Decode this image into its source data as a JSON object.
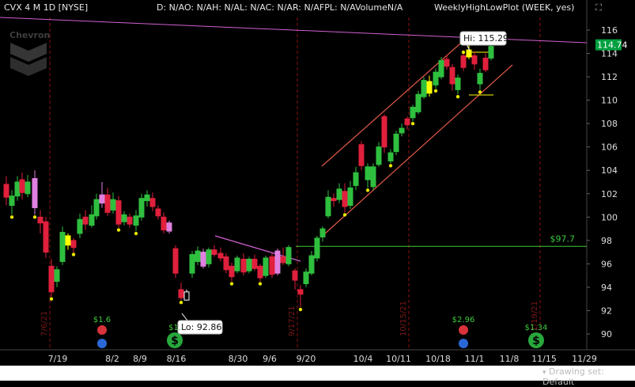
{
  "header": {
    "symbol_period": "CVX 4 M 1D [NYSE]",
    "study_values": "D: N/AO: N/AH: N/AL: N/AC: N/AR: N/AFPL: N/AVolumeN/A",
    "study_name": "WeeklyHighLowPlot (WEEK, yes)"
  },
  "watermark": {
    "brand": "Chevron"
  },
  "price_axis": {
    "ticks": [
      "116",
      "114",
      "112",
      "110",
      "108",
      "106",
      "104",
      "102",
      "100",
      "98",
      "96",
      "94",
      "92",
      "90"
    ],
    "current_price": "114.74",
    "current_price_color": "#00a040"
  },
  "time_axis": {
    "labels": [
      "7/19",
      "8/2",
      "8/9",
      "8/16",
      "8/30",
      "9/6",
      "9/20",
      "10/4",
      "10/11",
      "10/18",
      "11/1",
      "11/8",
      "11/15",
      "11/29"
    ]
  },
  "period_markers": [
    "7/6/21",
    "9/17/21",
    "10/15/21",
    "11/19/21"
  ],
  "annotations": {
    "high_bubble": "Hi: 115.29",
    "low_bubble": "Lo: 92.86",
    "support_level": "$97.7"
  },
  "events": {
    "dividends": [
      "$1.6",
      "$1.",
      "$2.96",
      "$1.34"
    ]
  },
  "colors": {
    "up": "#2fbf3f",
    "down": "#e0203c",
    "weekly_high": "#ffff00",
    "weekly_low": "#ffff00",
    "highlight": "#e080e0",
    "channel": "#e05848",
    "trendline": "#d060d0",
    "support": "#3cc83c",
    "marker_line": "#8a1010"
  },
  "chart_data": {
    "type": "candlestick",
    "ylim": [
      89,
      117.5
    ],
    "x": [
      "7/19",
      "8/2",
      "8/9",
      "8/16",
      "8/30",
      "9/6",
      "9/20",
      "10/4",
      "10/11",
      "10/18",
      "11/1"
    ],
    "approx_closes": [
      98.5,
      101,
      99.5,
      93.5,
      95.5,
      96,
      98,
      103,
      107.5,
      113,
      113.5
    ],
    "support_value": 97.7,
    "hi": 115.29,
    "lo": 92.86,
    "last": 114.74
  },
  "bottom_bar": {
    "drawing_label": "Drawing set: Default"
  }
}
